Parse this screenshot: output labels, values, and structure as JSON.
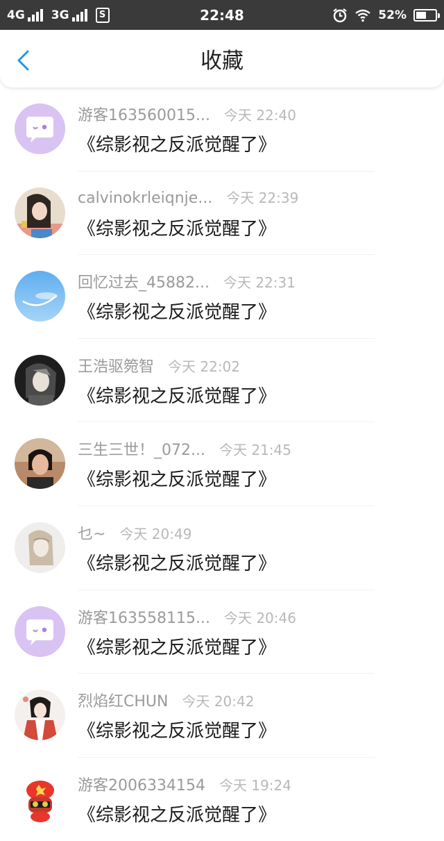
{
  "status_bar": {
    "network_1": "4G",
    "network_2": "3G",
    "s_badge": "S",
    "time": "22:48",
    "battery_text": "52%",
    "battery_level": 0.52,
    "icons": [
      "signal-icon",
      "alarm-icon",
      "wifi-icon",
      "battery-icon"
    ]
  },
  "header": {
    "title": "收藏",
    "back_icon": "chevron-left-icon",
    "accent": "#1e96f0"
  },
  "favorites": [
    {
      "user": "游客163560015...",
      "time": "今天 22:40",
      "book": "《综影视之反派觉醒了》",
      "avatar": "guest-chat-bubble"
    },
    {
      "user": "calvinokrleiqnje...",
      "time": "今天 22:39",
      "book": "《综影视之反派觉醒了》",
      "avatar": "photo"
    },
    {
      "user": "回忆过去_45882...",
      "time": "今天 22:31",
      "book": "《综影视之反派觉醒了》",
      "avatar": "sky-photo"
    },
    {
      "user": "王浩驱箢智",
      "time": "今天 22:02",
      "book": "《综影视之反派觉醒了》",
      "avatar": "anime-photo"
    },
    {
      "user": "三生三世！_072...",
      "time": "今天 21:45",
      "book": "《综影视之反派觉醒了》",
      "avatar": "photo"
    },
    {
      "user": "乜~",
      "time": "今天 20:49",
      "book": "《综影视之反派觉醒了》",
      "avatar": "photo"
    },
    {
      "user": "游客163558115...",
      "time": "今天 20:46",
      "book": "《综影视之反派觉醒了》",
      "avatar": "guest-chat-bubble"
    },
    {
      "user": "烈焰红CHUN",
      "time": "今天 20:42",
      "book": "《综影视之反派觉醒了》",
      "avatar": "illustration"
    },
    {
      "user": "游客2006334154",
      "time": "今天 19:24",
      "book": "《综影视之反派觉醒了》",
      "avatar": "cartoon"
    }
  ]
}
